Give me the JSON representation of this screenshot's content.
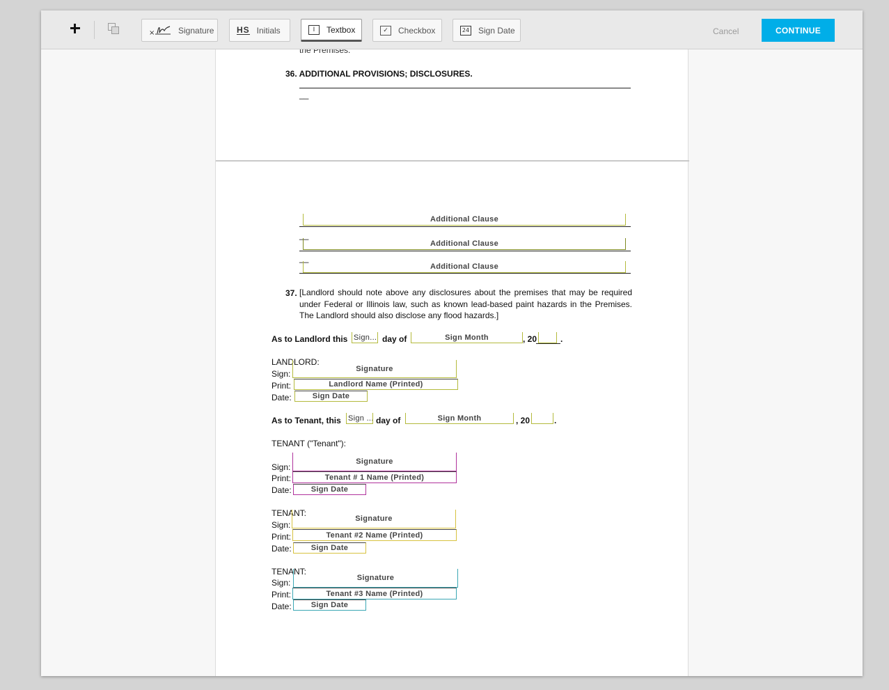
{
  "toolbar": {
    "tools": [
      {
        "label": "Signature",
        "icon": "signature-icon",
        "glyph": "×"
      },
      {
        "label": "Initials",
        "icon": "initials-icon",
        "glyph": "HS"
      },
      {
        "label": "Textbox",
        "icon": "textbox-icon",
        "glyph": "I",
        "active": true
      },
      {
        "label": "Checkbox",
        "icon": "checkbox-icon",
        "glyph": "✓"
      },
      {
        "label": "Sign Date",
        "icon": "calendar-icon",
        "glyph": "24"
      }
    ],
    "cancel_label": "Cancel",
    "continue_label": "CONTINUE",
    "accent_color": "#00aee8"
  },
  "document": {
    "top_fragment": "the Premises.",
    "section36_heading": "36. ADDITIONAL PROVISIONS; DISCLOSURES.",
    "short_dash": "__",
    "additional_clause_fields": [
      "Additional Clause",
      "Additional Clause",
      "Additional Clause"
    ],
    "section37_number": "37.",
    "section37_text": "[Landlord should note above any disclosures about the premises that may be required under Federal or Illinois law, such as known lead-based paint hazards in the Premises. The Landlord should also disclose any flood hazards.]",
    "landlord_dated": {
      "prefix": "As to Landlord this",
      "day_field": "Sign...",
      "day_of": "day of",
      "month_field": "Sign Month",
      "year_prefix": ", 20",
      "period": "."
    },
    "landlord_block": {
      "heading": "LANDLORD:",
      "sign_label": "Sign:",
      "print_label": "Print:",
      "date_label": "Date:",
      "signature_field": "Signature",
      "name_field": "Landlord Name (Printed)",
      "date_field": "Sign Date"
    },
    "tenant_dated": {
      "prefix": "As to Tenant, this",
      "day_field": "Sign ...",
      "day_of": "day of",
      "month_field": "Sign Month",
      "year_prefix": ", 20",
      "period": "."
    },
    "tenant_heading": "TENANT (\"Tenant\"):",
    "tenants": [
      {
        "heading": "",
        "sign_label": "Sign:",
        "print_label": "Print:",
        "date_label": "Date:",
        "signature_field": "Signature",
        "name_field": "Tenant # 1 Name (Printed)",
        "date_field": "Sign Date",
        "color": "#b0329c"
      },
      {
        "heading": "TENANT:",
        "sign_label": "Sign:",
        "print_label": "Print:",
        "date_label": "Date:",
        "signature_field": "Signature",
        "name_field": "Tenant #2 Name (Printed)",
        "date_field": "Sign Date",
        "color": "#d7c23f"
      },
      {
        "heading": "TENANT:",
        "sign_label": "Sign:",
        "print_label": "Print:",
        "date_label": "Date:",
        "signature_field": "Signature",
        "name_field": "Tenant #3 Name (Printed)",
        "date_field": "Sign Date",
        "color": "#3aa7b4"
      }
    ]
  }
}
